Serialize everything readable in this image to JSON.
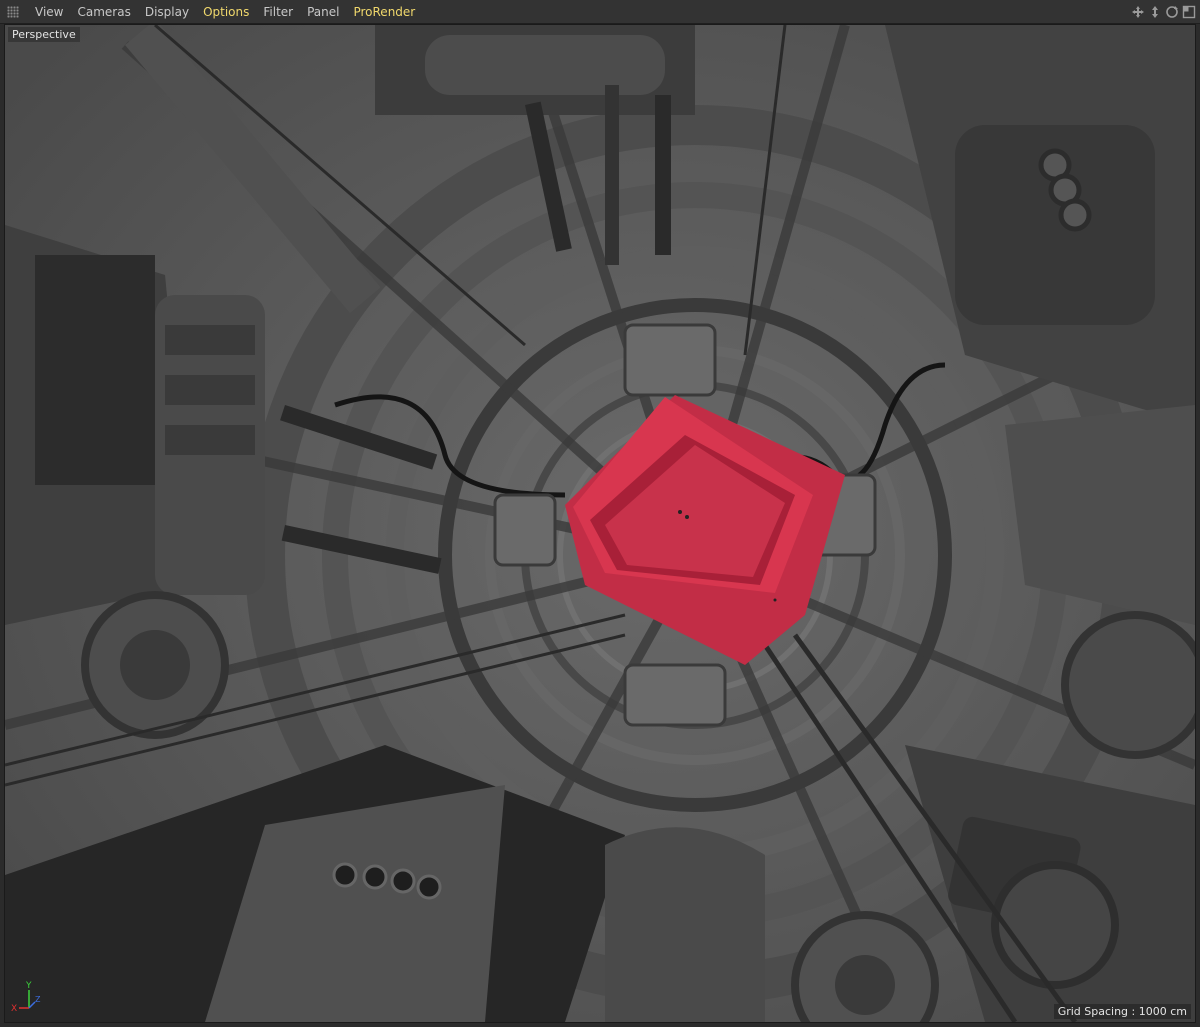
{
  "menu": {
    "items": [
      {
        "label": "View"
      },
      {
        "label": "Cameras"
      },
      {
        "label": "Display"
      },
      {
        "label": "Options",
        "highlight": true
      },
      {
        "label": "Filter"
      },
      {
        "label": "Panel"
      },
      {
        "label": "ProRender",
        "highlight": true
      }
    ]
  },
  "nav_icons": [
    "move-view-icon",
    "dolly-view-icon",
    "rotate-view-icon",
    "maximize-view-icon"
  ],
  "viewport": {
    "camera_label": "Perspective",
    "grid_spacing": "Grid Spacing : 1000 cm",
    "axes": {
      "x": "X",
      "y": "Y",
      "z": "Z"
    }
  },
  "colors": {
    "selected_object": "#d0344f",
    "accent_menu": "#f0d86c",
    "axis_x": "#e03030",
    "axis_y": "#3cd23c",
    "axis_z": "#3c6ee0"
  }
}
